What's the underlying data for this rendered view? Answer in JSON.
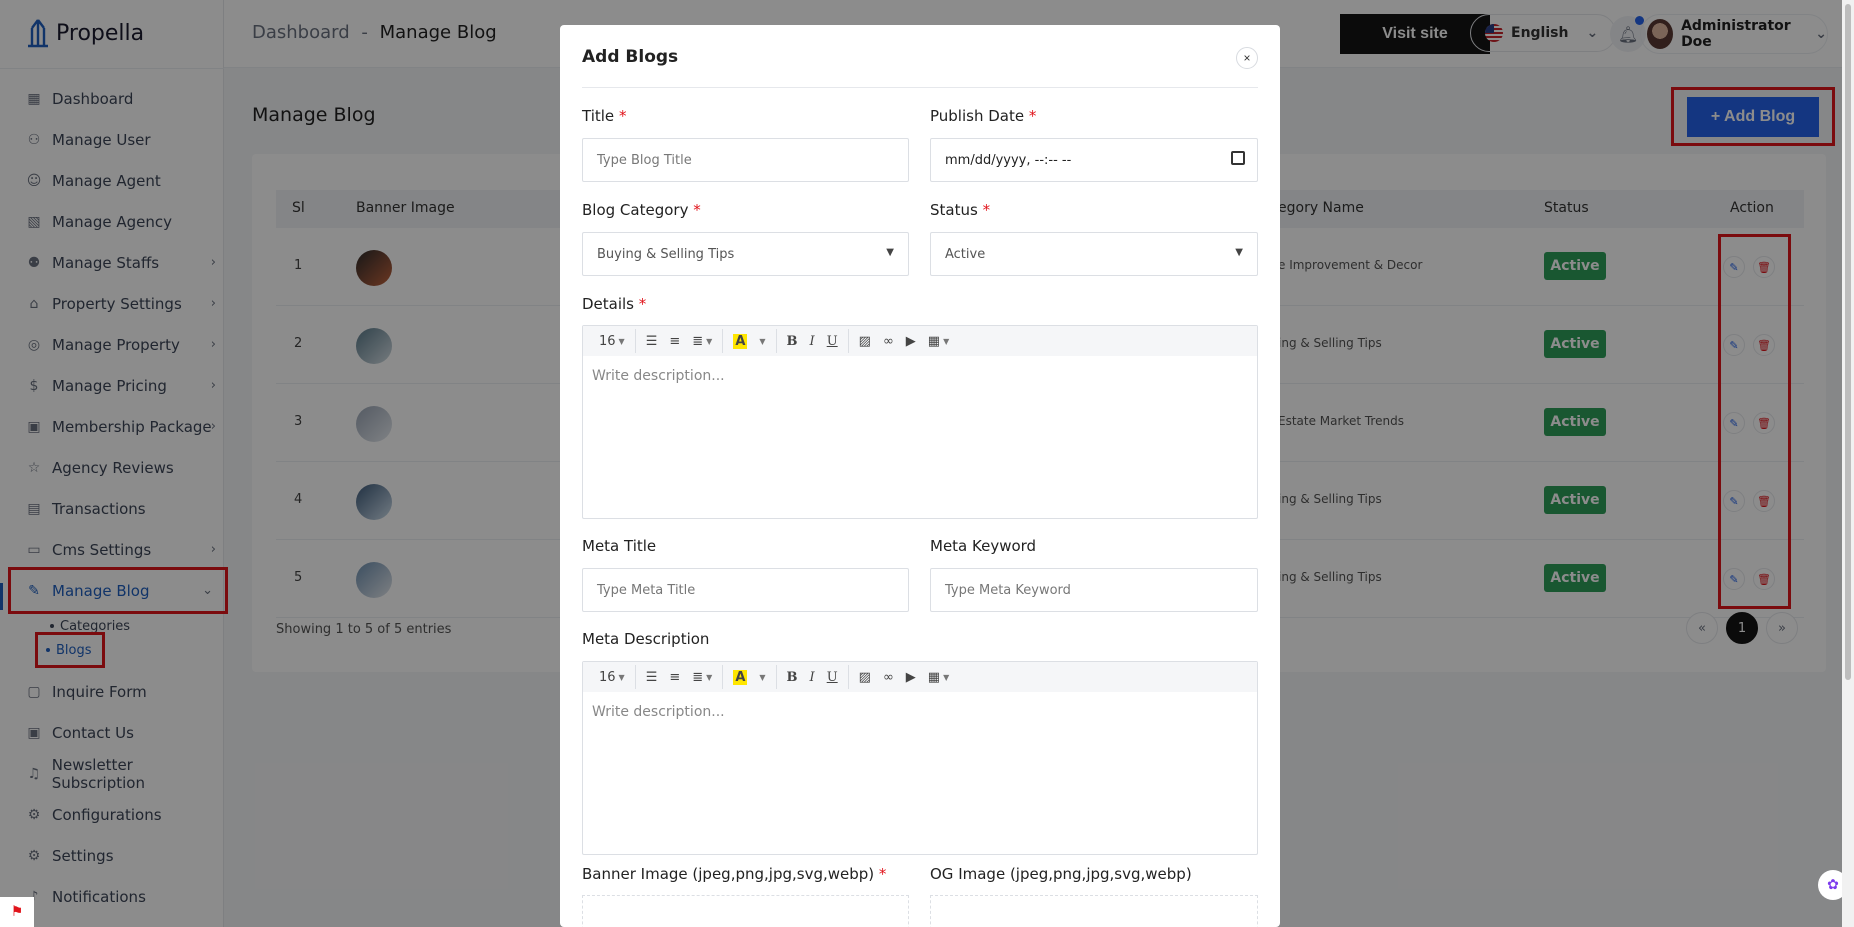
{
  "app": {
    "brand": "Propella"
  },
  "header": {
    "breadcrumb_root": "Dashboard",
    "breadcrumb_sep": "-",
    "breadcrumb_current": "Manage Blog",
    "visit_site": "Visit site",
    "language": "English",
    "user_name": "Administrator Doe"
  },
  "sidebar": {
    "items": [
      {
        "label": "Dashboard",
        "icon": "grid-icon",
        "chevron": false
      },
      {
        "label": "Manage User",
        "icon": "user-cog-icon",
        "chevron": false
      },
      {
        "label": "Manage Agent",
        "icon": "user-icon",
        "chevron": false
      },
      {
        "label": "Manage Agency",
        "icon": "agency-icon",
        "chevron": false
      },
      {
        "label": "Manage Staffs",
        "icon": "users-icon",
        "chevron": true
      },
      {
        "label": "Property Settings",
        "icon": "home-icon",
        "chevron": true
      },
      {
        "label": "Manage Property",
        "icon": "building-icon",
        "chevron": true
      },
      {
        "label": "Manage Pricing",
        "icon": "dollar-icon",
        "chevron": true
      },
      {
        "label": "Membership Package",
        "icon": "package-icon",
        "chevron": true
      },
      {
        "label": "Agency Reviews",
        "icon": "star-icon",
        "chevron": false
      },
      {
        "label": "Transactions",
        "icon": "receipt-icon",
        "chevron": false
      },
      {
        "label": "Cms Settings",
        "icon": "monitor-icon",
        "chevron": true
      },
      {
        "label": "Manage Blog",
        "icon": "blog-icon",
        "chevron": true
      },
      {
        "label": "Categories",
        "icon": "dot-icon",
        "chevron": false
      },
      {
        "label": "Blogs",
        "icon": "dot-icon",
        "chevron": false
      },
      {
        "label": "Inquire Form",
        "icon": "form-icon",
        "chevron": false
      },
      {
        "label": "Contact Us",
        "icon": "contact-icon",
        "chevron": false
      },
      {
        "label": "Newsletter Subscription",
        "icon": "bell-icon",
        "chevron": false
      },
      {
        "label": "Configurations",
        "icon": "sliders-icon",
        "chevron": false
      },
      {
        "label": "Settings",
        "icon": "gear-icon",
        "chevron": false
      },
      {
        "label": "Notifications",
        "icon": "notification-icon",
        "chevron": false
      }
    ]
  },
  "page": {
    "title": "Manage Blog",
    "add_button": "+ Add Blog",
    "columns": {
      "sl": "Sl",
      "banner": "Banner Image",
      "category": "egory Name",
      "status": "Status",
      "action": "Action"
    },
    "rows": [
      {
        "sl": "1",
        "category": "e Improvement & Decor",
        "status": "Active"
      },
      {
        "sl": "2",
        "category": "ing & Selling Tips",
        "status": "Active"
      },
      {
        "sl": "3",
        "category": "Estate Market Trends",
        "status": "Active"
      },
      {
        "sl": "4",
        "category": "ing & Selling Tips",
        "status": "Active"
      },
      {
        "sl": "5",
        "category": "ing & Selling Tips",
        "status": "Active"
      }
    ],
    "showing": "Showing 1 to 5 of 5 entries",
    "pagination": {
      "prev": "«",
      "current": "1",
      "next": "»"
    }
  },
  "modal": {
    "title": "Add Blogs",
    "close": "×",
    "title_label": "Title",
    "title_placeholder": "Type Blog Title",
    "publish_label": "Publish Date",
    "publish_placeholder": "mm/dd/yyyy, --:-- --",
    "category_label": "Blog Category",
    "category_value": "Buying & Selling Tips",
    "status_label": "Status",
    "status_value": "Active",
    "details_label": "Details",
    "font_size": "16",
    "editor_placeholder": "Write description...",
    "meta_title_label": "Meta Title",
    "meta_title_placeholder": "Type Meta Title",
    "meta_keyword_label": "Meta Keyword",
    "meta_keyword_placeholder": "Type Meta Keyword",
    "meta_desc_label": "Meta Description",
    "banner_label": "Banner Image (jpeg,png,jpg,svg,webp)",
    "og_label": "OG Image (jpeg,png,jpg,svg,webp)",
    "required_mark": "*"
  },
  "colors": {
    "accent": "#2563eb",
    "active_badge": "#2f9e5a",
    "highlight": "#e1141b",
    "sidebar_active": "#1f5fbf"
  }
}
